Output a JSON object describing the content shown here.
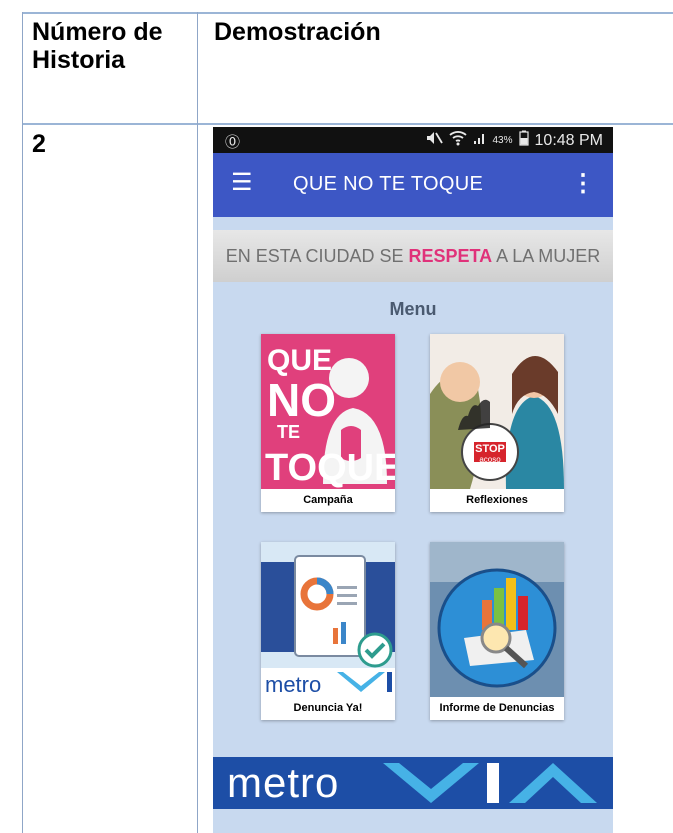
{
  "table": {
    "header": {
      "col1": "Número de Historia",
      "col2": "Demostración"
    },
    "row": {
      "number": "2"
    }
  },
  "phone": {
    "status": {
      "left_icon": "shield-icon",
      "battery": "43%",
      "time": "10:48 PM"
    },
    "appbar": {
      "title": "QUE NO TE TOQUE",
      "menu_icon": "hamburger-icon",
      "more_icon": "more-vert-icon"
    },
    "banner": {
      "pre": "EN ESTA CIUDAD SE ",
      "highlight": "RESPETA",
      "post": " A LA MUJER"
    },
    "menu_title": "Menu",
    "tiles": [
      {
        "caption": "Campaña",
        "logo": {
          "l1": "QUE",
          "l2": "NO",
          "l3": "TE",
          "l4": "TOQUE"
        }
      },
      {
        "caption": "Reflexiones",
        "stop": {
          "t1": "STOP",
          "t2": "acoso"
        }
      },
      {
        "caption": "Denuncia Ya!",
        "brand": "metro"
      },
      {
        "caption": "Informe de Denuncias"
      }
    ],
    "footer_brand": "metro"
  },
  "colors": {
    "appbar": "#3d57c5",
    "highlight": "#e0327a",
    "campaign_pink": "#e0407c",
    "metro_blue": "#1d4ea6",
    "metro_accent": "#46b2e6"
  }
}
